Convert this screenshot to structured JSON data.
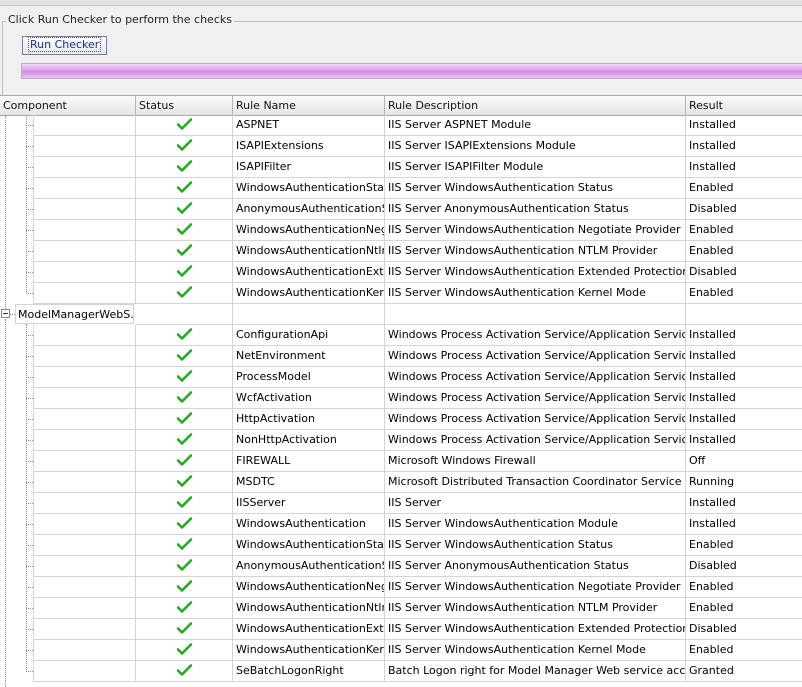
{
  "group": {
    "title": "Click Run Checker to perform the checks",
    "run_button": "Run Checker"
  },
  "columns": [
    "Component",
    "Status",
    "Rule Name",
    "Rule Description",
    "Result"
  ],
  "status_icon": "check-icon",
  "status_color": "#27a827",
  "parent_node": "ModelManagerWebS...",
  "rows_a": [
    {
      "name": "ASPNET",
      "desc": "IIS Server ASPNET Module",
      "result": "Installed"
    },
    {
      "name": "ISAPIExtensions",
      "desc": "IIS Server ISAPIExtensions Module",
      "result": "Installed"
    },
    {
      "name": "ISAPIFilter",
      "desc": "IIS Server ISAPIFilter Module",
      "result": "Installed"
    },
    {
      "name": "WindowsAuthenticationStatus",
      "desc": "IIS Server WindowsAuthentication Status",
      "result": "Enabled"
    },
    {
      "name": "AnonymousAuthenticationS...",
      "desc": "IIS Server AnonymousAuthentication Status",
      "result": "Disabled"
    },
    {
      "name": "WindowsAuthenticationNeg...",
      "desc": "IIS Server WindowsAuthentication Negotiate Provider",
      "result": "Enabled"
    },
    {
      "name": "WindowsAuthenticationNtlm...",
      "desc": "IIS Server WindowsAuthentication NTLM Provider",
      "result": "Enabled"
    },
    {
      "name": "WindowsAuthenticationExt...",
      "desc": "IIS Server WindowsAuthentication Extended Protection",
      "result": "Disabled"
    },
    {
      "name": "WindowsAuthenticationKer...",
      "desc": "IIS Server WindowsAuthentication Kernel Mode",
      "result": "Enabled"
    }
  ],
  "rows_b": [
    {
      "name": "ConfigurationApi",
      "desc": "Windows Process Activation Service/Application Services C...",
      "result": "Installed"
    },
    {
      "name": "NetEnvironment",
      "desc": "Windows Process Activation Service/Application Services N...",
      "result": "Installed"
    },
    {
      "name": "ProcessModel",
      "desc": "Windows Process Activation Service/Application Services P...",
      "result": "Installed"
    },
    {
      "name": "WcfActivation",
      "desc": "Windows Process Activation Service/Application Services ...",
      "result": "Installed"
    },
    {
      "name": "HttpActivation",
      "desc": "Windows Process Activation Service/Application Services H...",
      "result": "Installed"
    },
    {
      "name": "NonHttpActivation",
      "desc": "Windows Process Activation Service/Application Services N...",
      "result": "Installed"
    },
    {
      "name": "FIREWALL",
      "desc": "Microsoft Windows Firewall",
      "result": "Off"
    },
    {
      "name": "MSDTC",
      "desc": "Microsoft Distributed Transaction Coordinator Service",
      "result": "Running"
    },
    {
      "name": "IISServer",
      "desc": "IIS Server",
      "result": "Installed"
    },
    {
      "name": "WindowsAuthentication",
      "desc": "IIS Server WindowsAuthentication Module",
      "result": "Installed"
    },
    {
      "name": "WindowsAuthenticationStatus",
      "desc": "IIS Server WindowsAuthentication Status",
      "result": "Enabled"
    },
    {
      "name": "AnonymousAuthenticationS...",
      "desc": "IIS Server AnonymousAuthentication Status",
      "result": "Disabled"
    },
    {
      "name": "WindowsAuthenticationNeg...",
      "desc": "IIS Server WindowsAuthentication Negotiate Provider",
      "result": "Enabled"
    },
    {
      "name": "WindowsAuthenticationNtlm...",
      "desc": "IIS Server WindowsAuthentication NTLM Provider",
      "result": "Enabled"
    },
    {
      "name": "WindowsAuthenticationExt...",
      "desc": "IIS Server WindowsAuthentication Extended Protection",
      "result": "Disabled"
    },
    {
      "name": "WindowsAuthenticationKer...",
      "desc": "IIS Server WindowsAuthentication Kernel Mode",
      "result": "Enabled"
    },
    {
      "name": "SeBatchLogonRight",
      "desc": "Batch Logon right for Model Manager Web service account",
      "result": "Granted"
    }
  ]
}
